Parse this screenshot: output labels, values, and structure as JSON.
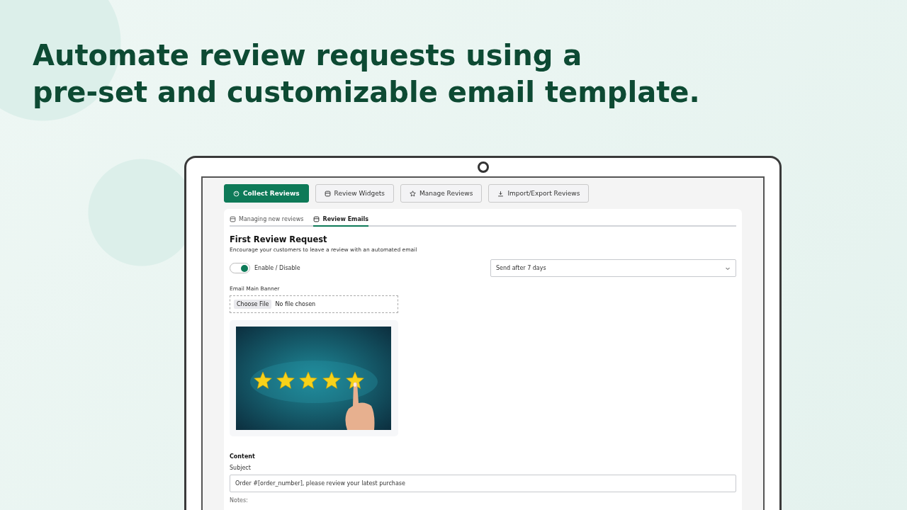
{
  "headline_lines": [
    "Automate review requests using a",
    "pre-set and customizable email template."
  ],
  "nav_buttons": [
    {
      "label": "Collect Reviews",
      "selected": true
    },
    {
      "label": "Review Widgets",
      "selected": false
    },
    {
      "label": "Manage Reviews",
      "selected": false
    },
    {
      "label": "Import/Export Reviews",
      "selected": false
    }
  ],
  "tabs": [
    {
      "label": "Managing new reviews",
      "selected": false
    },
    {
      "label": "Review Emails",
      "selected": true
    }
  ],
  "section": {
    "title": "First Review Request",
    "description": "Encourage your customers to leave a review with an automated email"
  },
  "toggle": {
    "label": "Enable / Disable",
    "on": true
  },
  "send_select": {
    "value": "Send after 7 days"
  },
  "banner": {
    "label": "Email Main Banner",
    "button": "Choose File",
    "status": "No file chosen"
  },
  "content": {
    "heading": "Content",
    "subject_label": "Subject",
    "subject_value": "Order #[order_number], please review your latest purchase",
    "notes_label": "Notes:"
  }
}
